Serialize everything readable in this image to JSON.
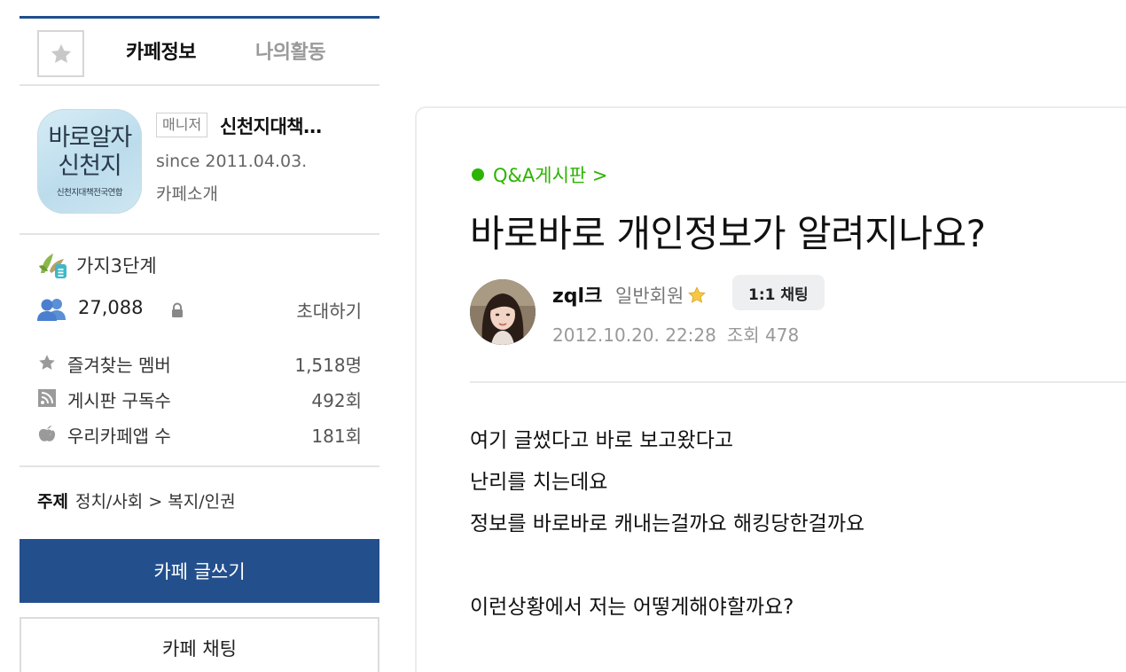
{
  "sidebar": {
    "tabs": {
      "active": "카페정보",
      "inactive": "나의활동"
    },
    "cafe": {
      "logo_line1": "바로알자",
      "logo_line2": "신천지",
      "logo_line3": "신천지대책전국연합",
      "manager_badge": "매니저",
      "name": "신천지대책…",
      "since": "since 2011.04.03.",
      "intro_link": "카페소개"
    },
    "grade": "가지3단계",
    "member_count": "27,088",
    "invite_label": "초대하기",
    "stats": [
      {
        "icon": "star-icon",
        "label": "즐겨찾는 멤버",
        "value": "1,518명"
      },
      {
        "icon": "rss-icon",
        "label": "게시판 구독수",
        "value": "492회"
      },
      {
        "icon": "apple-icon",
        "label": "우리카페앱 수",
        "value": "181회"
      }
    ],
    "topic": {
      "label": "주제",
      "value": "정치/사회 > 복지/인권"
    },
    "write_button": "카페 글쓰기",
    "chat_button": "카페 채팅"
  },
  "article": {
    "board_link": "Q&A게시판 >",
    "title": "바로바로 개인정보가 알려지나요?",
    "author": {
      "name": "zql크",
      "level": "일반회원",
      "chat_label": "1:1 채팅"
    },
    "date": "2012.10.20. 22:28",
    "views": "조회 478",
    "content_lines": [
      "여기 글썼다고 바로 보고왔다고",
      "난리를 치는데요",
      "정보를 바로바로 캐내는걸까요 해킹당한걸까요",
      "",
      "이런상황에서 저는 어떻게해야할까요?"
    ]
  },
  "colors": {
    "accent_blue": "#234f8d",
    "board_green": "#2db400"
  }
}
